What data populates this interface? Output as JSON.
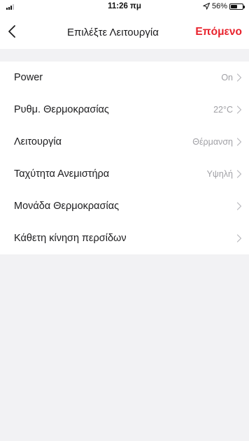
{
  "status_bar": {
    "time": "11:26 πμ",
    "battery": "56%",
    "battery_level": 0.56
  },
  "nav": {
    "title": "Επιλέξτε Λειτουργία",
    "next_label": "Επόμενο",
    "accent_color": "#e8232d"
  },
  "settings": [
    {
      "label": "Power",
      "value": "On"
    },
    {
      "label": "Ρυθμ. Θερμοκρασίας",
      "value": "22°C"
    },
    {
      "label": "Λειτουργία",
      "value": "Θέρμανση"
    },
    {
      "label": "Ταχύτητα Ανεμιστήρα",
      "value": "Υψηλή"
    },
    {
      "label": "Μονάδα Θερμοκρασίας",
      "value": ""
    },
    {
      "label": "Κάθετη κίνηση περσίδων",
      "value": ""
    }
  ]
}
